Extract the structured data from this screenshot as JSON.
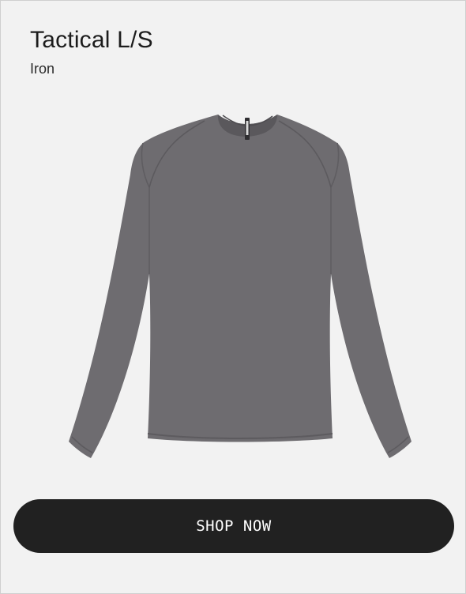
{
  "product": {
    "name": "Tactical L/S",
    "color": "Iron",
    "image_subject": "long-sleeve-shirt-icon",
    "shirt_color": "#6e6c70",
    "background": "#f2f2f2"
  },
  "cta": {
    "label": "SHOP  NOW",
    "background": "#212121"
  }
}
